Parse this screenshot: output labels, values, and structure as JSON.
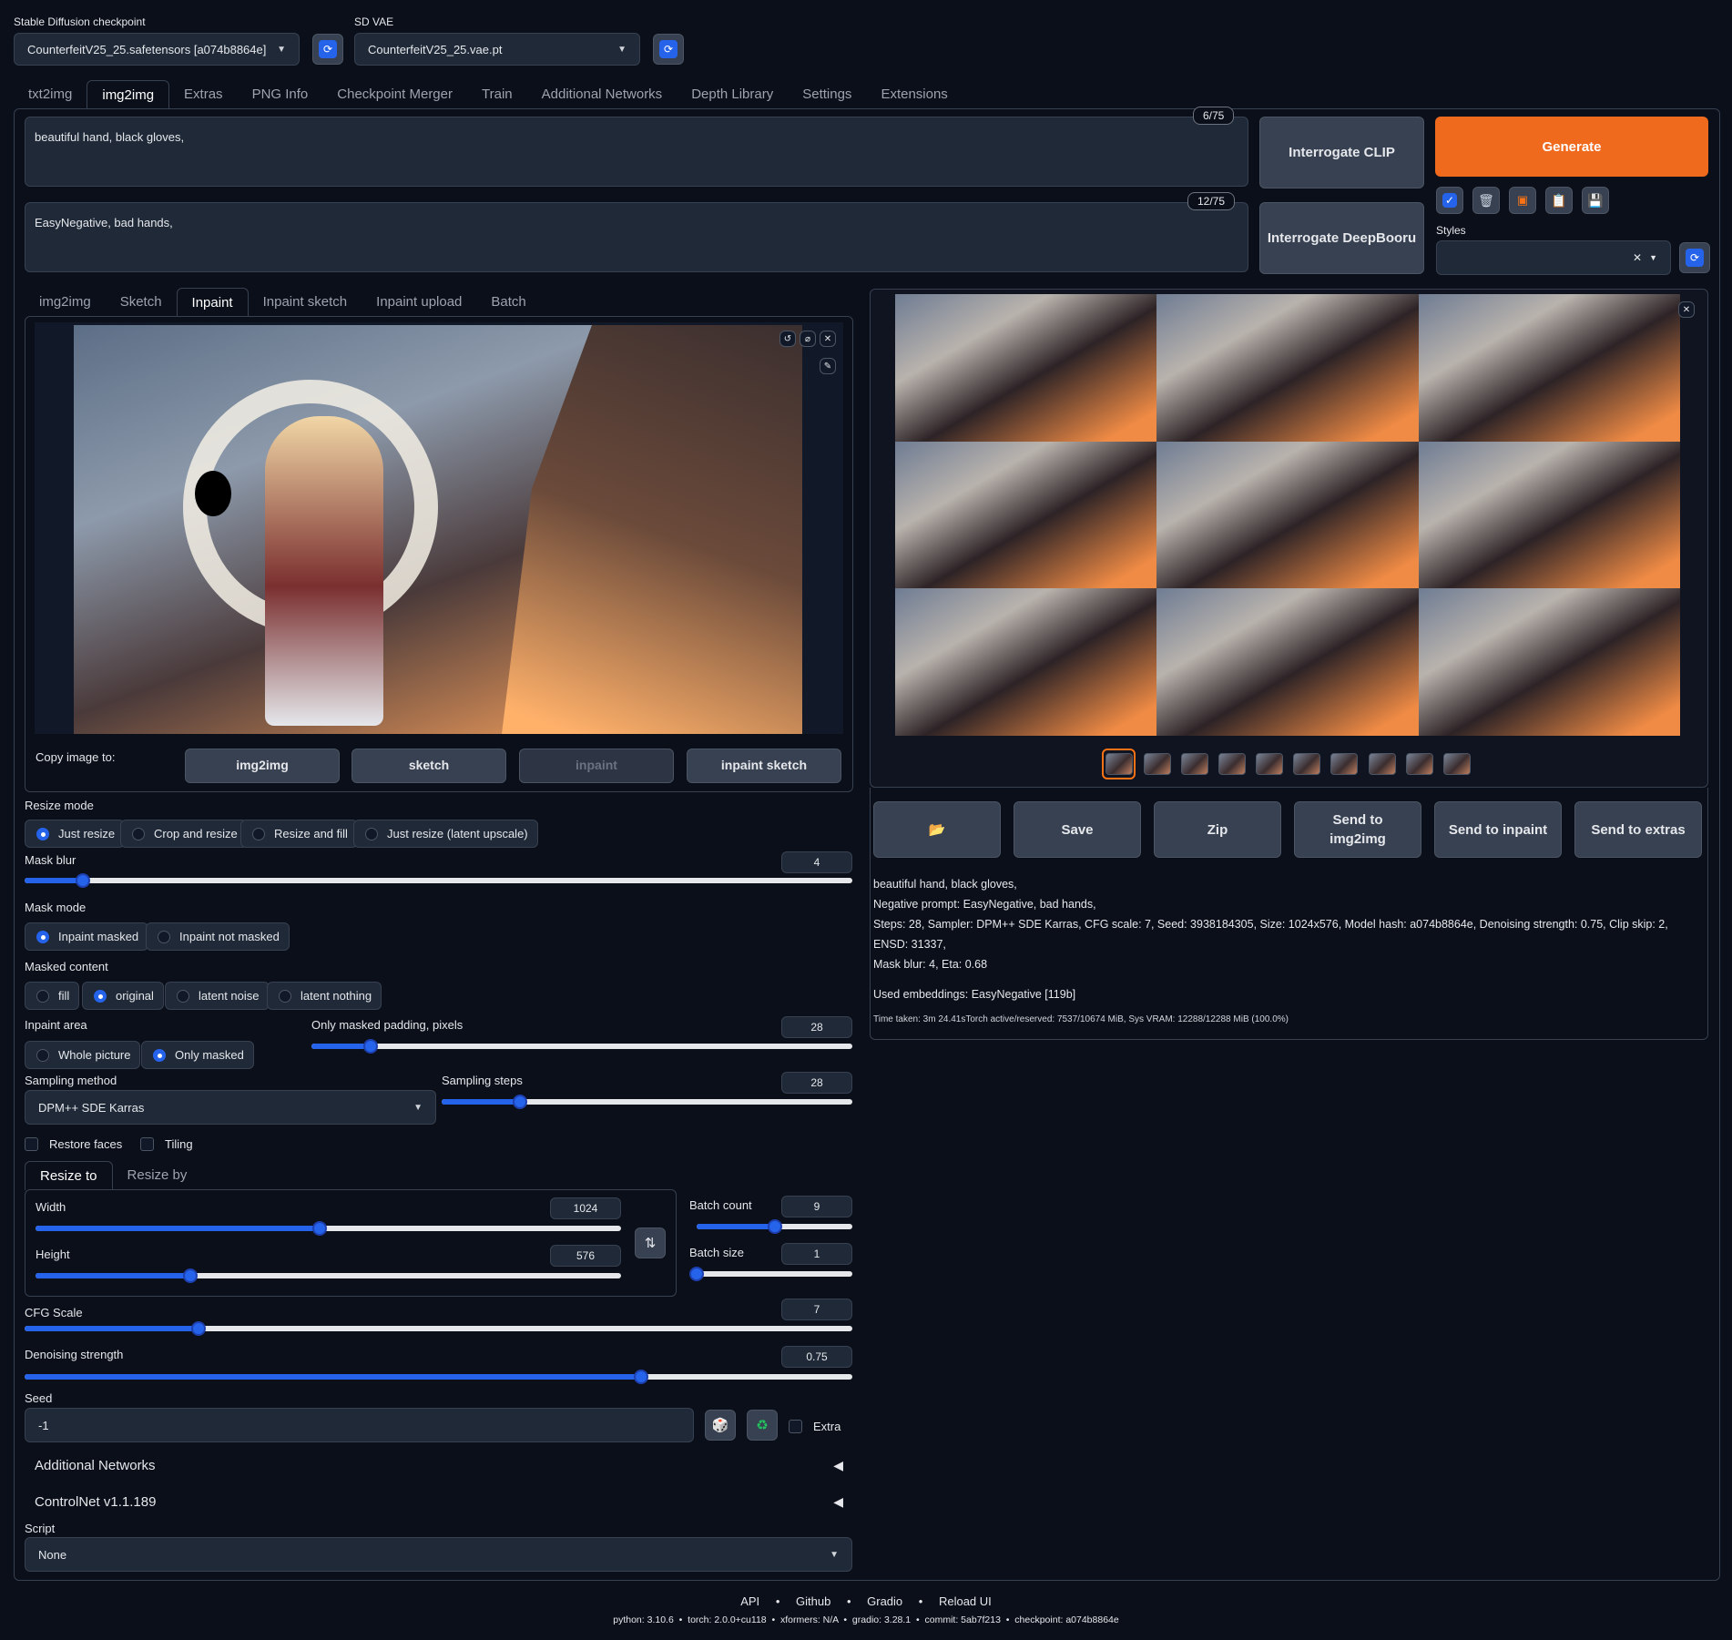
{
  "checkpoint": {
    "label": "Stable Diffusion checkpoint",
    "value": "CounterfeitV25_25.safetensors [a074b8864e]"
  },
  "vae": {
    "label": "SD VAE",
    "value": "CounterfeitV25_25.vae.pt"
  },
  "main_tabs": [
    "txt2img",
    "img2img",
    "Extras",
    "PNG Info",
    "Checkpoint Merger",
    "Train",
    "Additional Networks",
    "Depth Library",
    "Settings",
    "Extensions"
  ],
  "prompt": {
    "text": "beautiful hand, black gloves,",
    "counter": "6/75"
  },
  "negative_prompt": {
    "text": "EasyNegative, bad hands,",
    "counter": "12/75"
  },
  "buttons": {
    "interrogate_clip": "Interrogate CLIP",
    "interrogate_deepbooru": "Interrogate DeepBooru",
    "generate": "Generate"
  },
  "styles": {
    "label": "Styles",
    "clear": "✕"
  },
  "sub_tabs": [
    "img2img",
    "Sketch",
    "Inpaint",
    "Inpaint sketch",
    "Inpaint upload",
    "Batch"
  ],
  "copy_image": {
    "label": "Copy image to:",
    "buttons": [
      "img2img",
      "sketch",
      "inpaint",
      "inpaint sketch"
    ]
  },
  "resize_mode": {
    "label": "Resize mode",
    "options": [
      "Just resize",
      "Crop and resize",
      "Resize and fill",
      "Just resize (latent upscale)"
    ],
    "selected": "Just resize"
  },
  "mask_blur": {
    "label": "Mask blur",
    "value": "4",
    "fraction": 0.07
  },
  "mask_mode": {
    "label": "Mask mode",
    "options": [
      "Inpaint masked",
      "Inpaint not masked"
    ],
    "selected": "Inpaint masked"
  },
  "masked_content": {
    "label": "Masked content",
    "options": [
      "fill",
      "original",
      "latent noise",
      "latent nothing"
    ],
    "selected": "original"
  },
  "inpaint_area": {
    "label": "Inpaint area",
    "options": [
      "Whole picture",
      "Only masked"
    ],
    "selected": "Only masked"
  },
  "padding": {
    "label": "Only masked padding, pixels",
    "value": "28",
    "fraction": 0.11
  },
  "sampling_method": {
    "label": "Sampling method",
    "value": "DPM++ SDE Karras"
  },
  "sampling_steps": {
    "label": "Sampling steps",
    "value": "28",
    "fraction": 0.19
  },
  "restore_faces": "Restore faces",
  "tiling": "Tiling",
  "size_tabs": [
    "Resize to",
    "Resize by"
  ],
  "width": {
    "label": "Width",
    "value": "1024",
    "fraction": 0.485
  },
  "height": {
    "label": "Height",
    "value": "576",
    "fraction": 0.265
  },
  "batch_count": {
    "label": "Batch count",
    "value": "9",
    "fraction": 0.5
  },
  "batch_size": {
    "label": "Batch size",
    "value": "1",
    "fraction": 0.0
  },
  "cfg_scale": {
    "label": "CFG Scale",
    "value": "7",
    "fraction": 0.21
  },
  "denoising": {
    "label": "Denoising strength",
    "value": "0.75",
    "fraction": 0.745
  },
  "seed": {
    "label": "Seed",
    "value": "-1",
    "extra": "Extra"
  },
  "accordions": [
    "Additional Networks",
    "ControlNet v1.1.189"
  ],
  "script": {
    "label": "Script",
    "value": "None"
  },
  "output_buttons": [
    "📂",
    "Save",
    "Zip",
    "Send to img2img",
    "Send to inpaint",
    "Send to extras"
  ],
  "info": {
    "prompt": "beautiful hand, black gloves,",
    "negative": "Negative prompt: EasyNegative, bad hands,",
    "params": "Steps: 28, Sampler: DPM++ SDE Karras, CFG scale: 7, Seed: 3938184305, Size: 1024x576, Model hash: a074b8864e, Denoising strength: 0.75, Clip skip: 2, ENSD: 31337,",
    "params2": "Mask blur: 4, Eta: 0.68",
    "embeddings": "Used embeddings: EasyNegative [119b]",
    "time": "Time taken: 3m 24.41sTorch active/reserved: 7537/10674 MiB, Sys VRAM: 12288/12288 MiB (100.0%)"
  },
  "footer": {
    "links": [
      "API",
      "Github",
      "Gradio",
      "Reload UI"
    ],
    "versions": "python: 3.10.6  •  torch: 2.0.0+cu118  •  xformers: N/A  •  gradio: 3.28.1  •  commit: 5ab7f213  •  checkpoint: a074b8864e"
  },
  "colors": {
    "accent": "#2563eb",
    "generate": "#f06a1d",
    "bg": "#0b0f19"
  }
}
